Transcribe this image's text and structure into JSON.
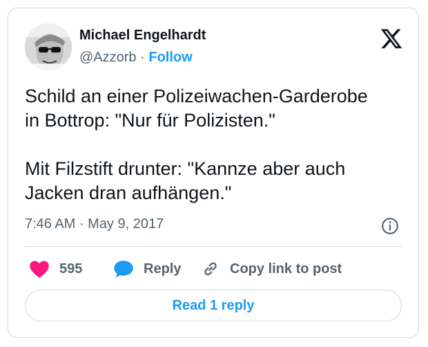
{
  "author": {
    "name": "Michael Engelhardt",
    "handle": "@Azzorb",
    "separator": "·",
    "follow_label": "Follow"
  },
  "tweet": {
    "text": "Schild an einer Polizeiwachen-Garderobe\nin Bottrop: \"Nur für Polizisten.\"\n\nMit Filzstift drunter: \"Kannze aber auch\nJacken dran aufhängen.\"",
    "timestamp": "7:46 AM · May 9, 2017"
  },
  "actions": {
    "like_count": "595",
    "reply_label": "Reply",
    "copy_link_label": "Copy link to post"
  },
  "read_replies_label": "Read 1 reply",
  "colors": {
    "accent": "#1d9bf0",
    "like": "#f91880",
    "text": "#0f1419",
    "muted": "#536471",
    "border": "#cfd9de"
  },
  "icons": {
    "logo": "x-logo-icon",
    "info": "info-icon",
    "like": "heart-icon",
    "reply": "speech-bubble-icon",
    "copy": "link-icon"
  }
}
